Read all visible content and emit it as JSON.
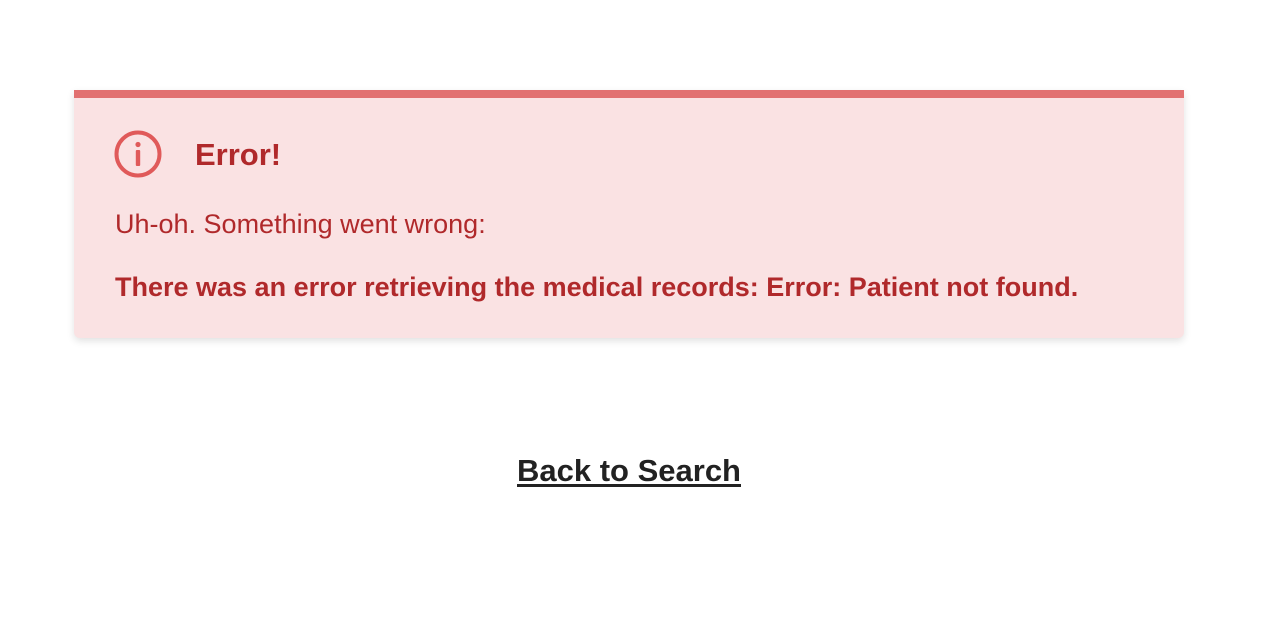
{
  "alert": {
    "icon": "info-circle-icon",
    "title": "Error!",
    "message": "Uh-oh. Something went wrong:",
    "detail": "There was an error retrieving the medical records: Error: Patient not found.",
    "colors": {
      "background": "#fae2e3",
      "border": "#e27171",
      "text": "#b0292b",
      "icon": "#e05a5a"
    }
  },
  "nav": {
    "back_label": "Back to Search"
  }
}
